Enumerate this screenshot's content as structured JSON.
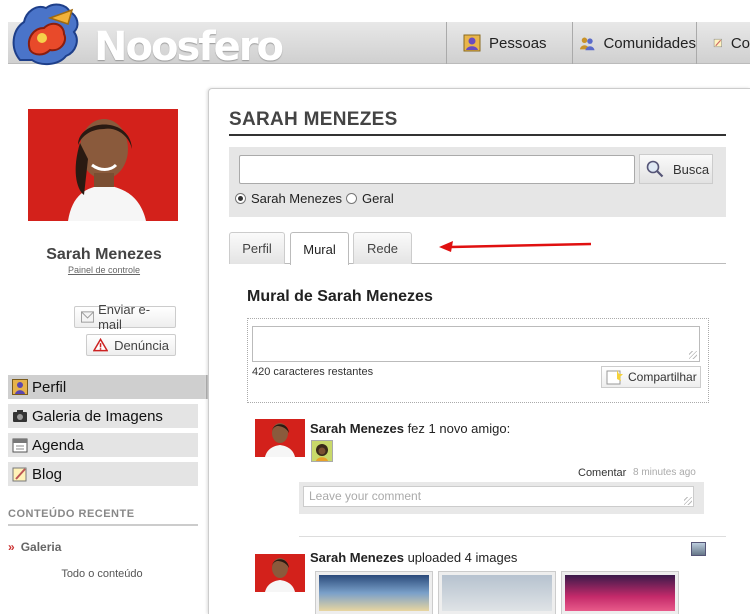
{
  "brand": {
    "logo_text": "Noosfero"
  },
  "nav": {
    "items": [
      {
        "label": "Pessoas",
        "icon": "person-icon"
      },
      {
        "label": "Comunidades",
        "icon": "community-icon"
      },
      {
        "label": "Co",
        "icon": "notepad-icon"
      }
    ]
  },
  "profile": {
    "name": "Sarah Menezes",
    "panel_link": "Painel de controle",
    "send_email": "Enviar e-mail",
    "report": "Denúncia"
  },
  "menu": {
    "items": [
      {
        "label": "Perfil",
        "icon": "profile-icon",
        "active": true
      },
      {
        "label": "Galeria de Imagens",
        "icon": "camera-icon",
        "active": false
      },
      {
        "label": "Agenda",
        "icon": "calendar-icon",
        "active": false
      },
      {
        "label": "Blog",
        "icon": "blog-icon",
        "active": false
      }
    ]
  },
  "recent": {
    "title": "CONTEÚDO RECENTE",
    "item": "Galeria",
    "all": "Todo o conteúdo"
  },
  "main": {
    "title": "SARAH MENEZES",
    "search": {
      "button": "Busca",
      "options": [
        "Sarah Menezes",
        "Geral"
      ],
      "selected": "Sarah Menezes",
      "value": ""
    },
    "tabs": [
      {
        "label": "Perfil",
        "active": false
      },
      {
        "label": "Mural",
        "active": true
      },
      {
        "label": "Rede",
        "active": false
      }
    ],
    "wall": {
      "title": "Mural de Sarah Menezes",
      "chars_left": "420 caracteres restantes",
      "share": "Compartilhar"
    },
    "feed": [
      {
        "author": "Sarah Menezes",
        "action": "fez 1 novo amigo:",
        "comment_link": "Comentar",
        "time": "8 minutes ago",
        "comment_placeholder": "Leave your comment"
      },
      {
        "author": "Sarah Menezes",
        "action": "uploaded 4 images"
      }
    ]
  },
  "colors": {
    "accent_red": "#d3211b",
    "arrow_red": "#e01010"
  }
}
